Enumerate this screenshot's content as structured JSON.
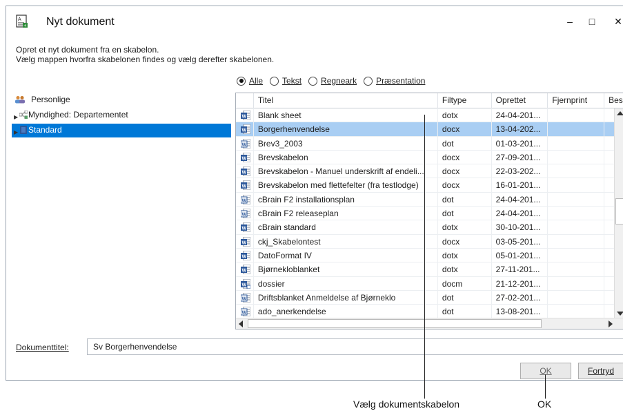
{
  "window": {
    "title": "Nyt dokument",
    "minimize": "‒",
    "maximize": "□",
    "close": "✕"
  },
  "description": {
    "line1": "Opret et nyt dokument fra en skabelon.",
    "line2": "Vælg mappen hvorfra skabelonen findes og vælg derefter skabelonen."
  },
  "filter": {
    "options": [
      {
        "label": "Alle",
        "checked": true
      },
      {
        "label": "Tekst",
        "checked": false
      },
      {
        "label": "Regneark",
        "checked": false
      },
      {
        "label": "Præsentation",
        "checked": false
      }
    ]
  },
  "tree": {
    "items": [
      {
        "label": "Personlige"
      },
      {
        "label": "Myndighed: Departementet"
      },
      {
        "label": "Standard"
      }
    ]
  },
  "grid": {
    "columns": [
      "Titel",
      "Filtype",
      "Oprettet",
      "Fjernprint",
      "Bes"
    ],
    "rows": [
      {
        "title": "Blank sheet",
        "type": "dotx",
        "date": "24-04-201..."
      },
      {
        "title": "Borgerhenvendelse",
        "type": "docx",
        "date": "13-04-202..."
      },
      {
        "title": "Brev3_2003",
        "type": "dot",
        "date": "01-03-201..."
      },
      {
        "title": "Brevskabelon",
        "type": "docx",
        "date": "27-09-201..."
      },
      {
        "title": "Brevskabelon - Manuel underskrift af endeli...",
        "type": "docx",
        "date": "22-03-202..."
      },
      {
        "title": "Brevskabelon med flettefelter (fra testlodge)",
        "type": "docx",
        "date": "16-01-201..."
      },
      {
        "title": "cBrain F2 installationsplan",
        "type": "dot",
        "date": "24-04-201..."
      },
      {
        "title": "cBrain F2 releaseplan",
        "type": "dot",
        "date": "24-04-201..."
      },
      {
        "title": "cBrain standard",
        "type": "dotx",
        "date": "30-10-201..."
      },
      {
        "title": "ckj_Skabelontest",
        "type": "docx",
        "date": "03-05-201..."
      },
      {
        "title": "DatoFormat IV",
        "type": "dotx",
        "date": "05-01-201..."
      },
      {
        "title": "Bjørnekloblanket",
        "type": "dotx",
        "date": "27-11-201..."
      },
      {
        "title": "dossier",
        "type": "docm",
        "date": "21-12-201..."
      },
      {
        "title": "Driftsblanket Anmeldelse af Bjørneklo",
        "type": "dot",
        "date": "27-02-201..."
      },
      {
        "title": "ado_anerkendelse",
        "type": "dot",
        "date": "13-08-201..."
      }
    ]
  },
  "doc_title": {
    "label": "Dokumenttitel:",
    "value": "Sv Borgerhenvendelse"
  },
  "buttons": {
    "ok": "OK",
    "cancel": "Fortryd"
  },
  "annotations": {
    "template": "Vælg dokumentskabelon",
    "ok": "OK"
  },
  "colors": {
    "selection": "#0078d7",
    "row_selection": "#a9cef3",
    "word_icon": "#2b579a"
  }
}
